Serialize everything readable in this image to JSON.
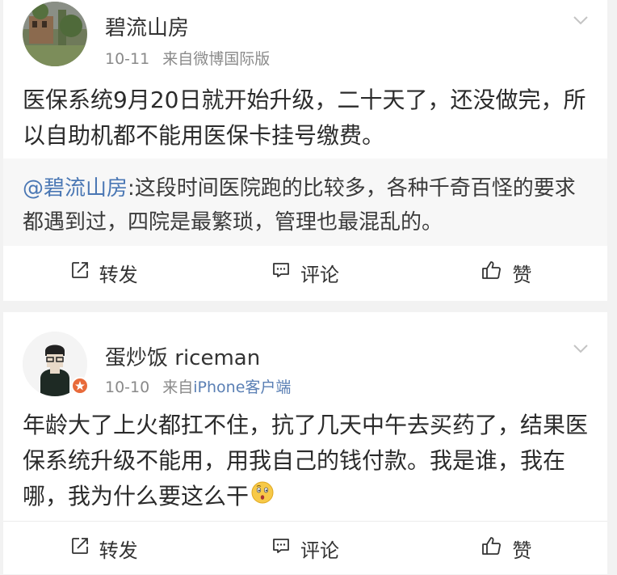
{
  "posts": [
    {
      "username": "碧流山房",
      "date": "10-11",
      "source_prefix": "来自",
      "source_name": "微博国际版",
      "body": "医保系统9月20日就开始升级，二十天了，还没做完，所以自助机都不能用医保卡挂号缴费。",
      "repost": {
        "mention": "@碧流山房",
        "text": ":这段时间医院跑的比较多，各种千奇百怪的要求都遇到过，四院是最繁琐，管理也最混乱的。"
      },
      "actions": {
        "repost": "转发",
        "comment": "评论",
        "like": "赞"
      }
    },
    {
      "username": "蛋炒饭 riceman",
      "date": "10-10",
      "source_prefix": "来自",
      "source_name": "iPhone客户端",
      "body": "年龄大了上火都扛不住，抗了几天中午去买药了，结果医保系统升级不能用，用我自己的钱付款。我是谁，我在哪，我为什么要这么干",
      "emoji": "thinking-face-emoji",
      "actions": {
        "repost": "转发",
        "comment": "评论",
        "like": "赞"
      }
    }
  ],
  "icons": {
    "repost": "share-arrow-icon",
    "comment": "comment-icon",
    "like": "thumbs-up-icon",
    "menu": "chevron-down-icon"
  },
  "colors": {
    "link": "#5a7fb4",
    "mention": "#4a77b4",
    "meta": "#8a8a8a",
    "repost_bg": "#f7f7f7",
    "feed_bg": "#f2f2f2"
  }
}
